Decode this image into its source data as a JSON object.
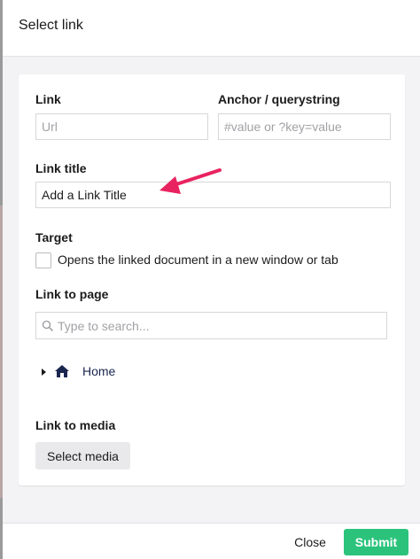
{
  "header": {
    "title": "Select link"
  },
  "link": {
    "label": "Link",
    "placeholder": "Url"
  },
  "anchor": {
    "label": "Anchor / querystring",
    "placeholder": "#value or ?key=value"
  },
  "link_title": {
    "label": "Link title",
    "value": "Add a Link Title"
  },
  "target": {
    "label": "Target",
    "checkbox_label": "Opens the linked document in a new window or tab",
    "checked": false
  },
  "link_to_page": {
    "label": "Link to page",
    "search_placeholder": "Type to search...",
    "tree": [
      {
        "label": "Home",
        "icon": "home-icon"
      }
    ]
  },
  "link_to_media": {
    "label": "Link to media",
    "button": "Select media"
  },
  "footer": {
    "close": "Close",
    "submit": "Submit"
  },
  "colors": {
    "accent": "#2bc37c",
    "annotation_arrow": "#e8235f"
  }
}
